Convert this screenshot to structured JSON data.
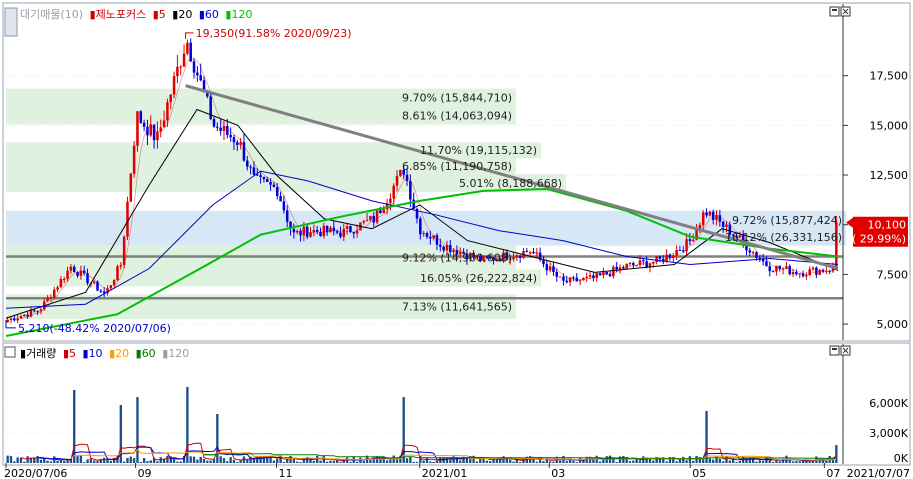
{
  "price_panel": {
    "legend": [
      {
        "text": "대기매물(10)",
        "color": "#9aa0a6"
      },
      {
        "text": "제노포커스",
        "color": "#d00000"
      },
      {
        "text": "5",
        "color": "#d00000"
      },
      {
        "text": "20",
        "color": "#000000"
      },
      {
        "text": "60",
        "color": "#0000cc"
      },
      {
        "text": "120",
        "color": "#00c000"
      }
    ],
    "high_annotation": "19,350(91.58% 2020/09/23)",
    "low_annotation": "5,210(-48.42% 2020/07/06)",
    "current_price": "10,100",
    "current_change": "( 29.99%)"
  },
  "volume_panel": {
    "legend": [
      {
        "text": "거래량",
        "color": "#000000"
      },
      {
        "text": "5",
        "color": "#d00000"
      },
      {
        "text": "10",
        "color": "#0000cc"
      },
      {
        "text": "20",
        "color": "#ff9900"
      },
      {
        "text": "60",
        "color": "#008000"
      },
      {
        "text": "120",
        "color": "#9aa0a6"
      }
    ]
  },
  "x_axis_labels": [
    "2020/07/06",
    "09",
    "11",
    "2021/01",
    "03",
    "05",
    "07",
    "2021/07/07"
  ],
  "chart_data": [
    {
      "type": "candlestick",
      "title": "제노포커스",
      "ylim": [
        4200,
        20000
      ],
      "y_ticks": [
        5000,
        7500,
        10000,
        12500,
        15000,
        17500
      ],
      "y_tick_labels": [
        "5,000",
        "7,500",
        "10,000",
        "12,500",
        "15,000",
        "17,500"
      ],
      "period": [
        "2020/07/06",
        "2021/07/07"
      ],
      "price_path": [
        {
          "date": "2020/07/06",
          "price": 5210
        },
        {
          "date": "2020/07/20",
          "price": 5700
        },
        {
          "date": "2020/08/03",
          "price": 7900
        },
        {
          "date": "2020/08/18",
          "price": 6500
        },
        {
          "date": "2020/08/25",
          "price": 8000
        },
        {
          "date": "2020/09/01",
          "price": 15500
        },
        {
          "date": "2020/09/10",
          "price": 14300
        },
        {
          "date": "2020/09/23",
          "price": 19350
        },
        {
          "date": "2020/10/05",
          "price": 15000
        },
        {
          "date": "2020/10/16",
          "price": 14200
        },
        {
          "date": "2020/10/23",
          "price": 12200
        },
        {
          "date": "2020/11/02",
          "price": 11800
        },
        {
          "date": "2020/11/09",
          "price": 9500
        },
        {
          "date": "2020/11/16",
          "price": 9700
        },
        {
          "date": "2020/12/01",
          "price": 9600
        },
        {
          "date": "2020/12/15",
          "price": 10300
        },
        {
          "date": "2020/12/28",
          "price": 12800
        },
        {
          "date": "2021/01/04",
          "price": 9800
        },
        {
          "date": "2021/01/14",
          "price": 9000
        },
        {
          "date": "2021/02/01",
          "price": 8200
        },
        {
          "date": "2021/02/22",
          "price": 8700
        },
        {
          "date": "2021/03/08",
          "price": 7100
        },
        {
          "date": "2021/03/22",
          "price": 7300
        },
        {
          "date": "2021/04/05",
          "price": 7900
        },
        {
          "date": "2021/04/20",
          "price": 8200
        },
        {
          "date": "2021/05/03",
          "price": 9100
        },
        {
          "date": "2021/05/10",
          "price": 10700
        },
        {
          "date": "2021/05/24",
          "price": 9400
        },
        {
          "date": "2021/06/07",
          "price": 7900
        },
        {
          "date": "2021/06/21",
          "price": 7600
        },
        {
          "date": "2021/07/06",
          "price": 7800
        },
        {
          "date": "2021/07/07",
          "price": 10100
        }
      ],
      "moving_averages": [
        {
          "name": "5",
          "color": "#d00000"
        },
        {
          "name": "20",
          "color": "#000000",
          "points": [
            {
              "date": "2020/07/06",
              "price": 5300
            },
            {
              "date": "2020/08/10",
              "price": 6600
            },
            {
              "date": "2020/09/07",
              "price": 12000
            },
            {
              "date": "2020/09/28",
              "price": 15800
            },
            {
              "date": "2020/10/16",
              "price": 15000
            },
            {
              "date": "2020/11/02",
              "price": 12500
            },
            {
              "date": "2020/11/23",
              "price": 10300
            },
            {
              "date": "2020/12/14",
              "price": 9800
            },
            {
              "date": "2021/01/04",
              "price": 11000
            },
            {
              "date": "2021/01/25",
              "price": 9200
            },
            {
              "date": "2021/02/22",
              "price": 8400
            },
            {
              "date": "2021/03/22",
              "price": 7600
            },
            {
              "date": "2021/04/26",
              "price": 8000
            },
            {
              "date": "2021/05/17",
              "price": 9800
            },
            {
              "date": "2021/06/07",
              "price": 9100
            },
            {
              "date": "2021/07/07",
              "price": 7700
            }
          ]
        },
        {
          "name": "60",
          "color": "#0000cc",
          "points": [
            {
              "date": "2020/07/06",
              "price": 5800
            },
            {
              "date": "2020/08/10",
              "price": 6000
            },
            {
              "date": "2020/09/07",
              "price": 7800
            },
            {
              "date": "2020/10/05",
              "price": 11000
            },
            {
              "date": "2020/10/26",
              "price": 12700
            },
            {
              "date": "2020/11/16",
              "price": 12200
            },
            {
              "date": "2020/12/14",
              "price": 11200
            },
            {
              "date": "2021/01/11",
              "price": 10500
            },
            {
              "date": "2021/02/08",
              "price": 9700
            },
            {
              "date": "2021/03/08",
              "price": 9200
            },
            {
              "date": "2021/04/05",
              "price": 8400
            },
            {
              "date": "2021/05/03",
              "price": 8000
            },
            {
              "date": "2021/06/07",
              "price": 8300
            },
            {
              "date": "2021/07/07",
              "price": 8000
            }
          ]
        },
        {
          "name": "120",
          "color": "#00c000",
          "points": [
            {
              "date": "2020/07/06",
              "price": 4400
            },
            {
              "date": "2020/08/24",
              "price": 5500
            },
            {
              "date": "2020/09/28",
              "price": 7700
            },
            {
              "date": "2020/10/26",
              "price": 9500
            },
            {
              "date": "2020/11/30",
              "price": 10400
            },
            {
              "date": "2021/01/04",
              "price": 11200
            },
            {
              "date": "2021/02/01",
              "price": 11700
            },
            {
              "date": "2021/03/01",
              "price": 11800
            },
            {
              "date": "2021/04/05",
              "price": 10700
            },
            {
              "date": "2021/05/03",
              "price": 9400
            },
            {
              "date": "2021/06/07",
              "price": 8800
            },
            {
              "date": "2021/07/07",
              "price": 8400
            }
          ]
        }
      ],
      "trendline": [
        {
          "date": "2020/09/23",
          "price": 17000
        },
        {
          "date": "2021/07/07",
          "price": 7800
        }
      ],
      "horizontal_lines": [
        8400,
        6300
      ],
      "volume_profile": [
        {
          "price_from": 15950,
          "price_to": 16850,
          "label": "9.70% (15,844,710)"
        },
        {
          "price_from": 15050,
          "price_to": 15950,
          "label": "8.61% (14,063,094)"
        },
        {
          "price_from": 13350,
          "price_to": 14150,
          "label": "11.70% (19,115,132)"
        },
        {
          "price_from": 12550,
          "price_to": 13350,
          "label": "6.85% (11,190,758)"
        },
        {
          "price_from": 11650,
          "price_to": 12550,
          "label": "5.01% (8,188,668)"
        },
        {
          "price_from": 9800,
          "price_to": 10700,
          "label": "9.72% (15,877,424)",
          "highlight": true
        },
        {
          "price_from": 8950,
          "price_to": 9800,
          "label": "16.12% (26,331,156)",
          "highlight": true
        },
        {
          "price_from": 7750,
          "price_to": 8950,
          "label": "9.12% (14,900,608)"
        },
        {
          "price_from": 6900,
          "price_to": 7750,
          "label": "16.05% (26,222,824)"
        },
        {
          "price_from": 5250,
          "price_to": 6500,
          "label": "7.13% (11,641,565)"
        }
      ]
    },
    {
      "type": "bar",
      "title": "거래량",
      "ylim": [
        0,
        9500000
      ],
      "y_ticks": [
        0,
        3000000,
        6000000
      ],
      "y_tick_labels": [
        "0K",
        "3,000K",
        "6,000K"
      ],
      "spikes": [
        {
          "date": "2020/08/05",
          "value": 7300000
        },
        {
          "date": "2020/08/25",
          "value": 5800000
        },
        {
          "date": "2020/09/01",
          "value": 8100000
        },
        {
          "date": "2020/09/02",
          "value": 6600000
        },
        {
          "date": "2020/09/23",
          "value": 7600000
        },
        {
          "date": "2020/10/06",
          "value": 4900000
        },
        {
          "date": "2020/12/28",
          "value": 6600000
        },
        {
          "date": "2021/05/10",
          "value": 5200000
        },
        {
          "date": "2021/07/07",
          "value": 1800000
        }
      ],
      "typical_volume": 300000
    }
  ]
}
